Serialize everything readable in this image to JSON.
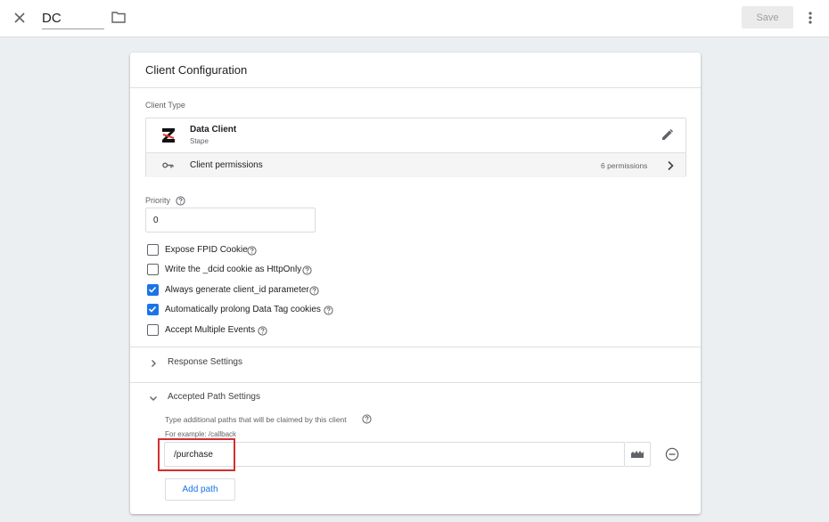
{
  "topbar": {
    "container_name": "DC",
    "save_label": "Save"
  },
  "card": {
    "title": "Client Configuration",
    "client_type_label": "Client Type",
    "client": {
      "name": "Data Client",
      "vendor": "Stape"
    },
    "permissions": {
      "label": "Client permissions",
      "count": "6 permissions"
    },
    "priority": {
      "label": "Priority",
      "value": "0"
    },
    "checkboxes": [
      {
        "label": "Expose FPID Cookie",
        "checked": false
      },
      {
        "label": "Write the _dcid cookie as HttpOnly",
        "checked": false
      },
      {
        "label": "Always generate client_id parameter",
        "checked": true
      },
      {
        "label": "Automatically prolong Data Tag cookies",
        "checked": true
      },
      {
        "label": "Accept Multiple Events",
        "checked": false
      }
    ],
    "response_settings": {
      "title": "Response Settings",
      "expanded": false
    },
    "accepted_path_settings": {
      "title": "Accepted Path Settings",
      "expanded": true,
      "description": "Type additional paths that will be claimed by this client",
      "example": "For example: /callback",
      "path_value": "/purchase",
      "add_path_label": "Add path"
    }
  },
  "colors": {
    "accent": "#1a73e8",
    "highlight": "#d32f2f",
    "background": "#eceff1"
  }
}
